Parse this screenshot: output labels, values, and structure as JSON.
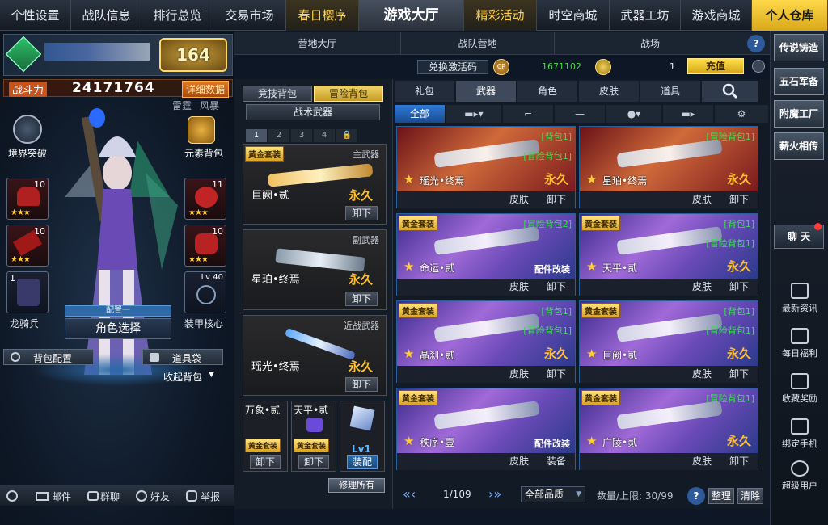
{
  "topnav": {
    "items": [
      "个性设置",
      "战队信息",
      "排行总览",
      "交易市场",
      "春日樱序",
      "游戏大厅",
      "精彩活动",
      "时空商城",
      "武器工坊",
      "游戏商城",
      "个人仓库"
    ]
  },
  "player": {
    "level": "164",
    "power_label": "战斗力",
    "power_value": "24171764",
    "detail_button": "详细数据",
    "tag_left": "雷霆",
    "tag_right": "风暴",
    "realm_breakthrough": "境界突破",
    "element_bag": "元素背包",
    "slots": [
      {
        "num": "10",
        "stars": "★★★"
      },
      {
        "num": "10",
        "stars": "★★★"
      },
      {
        "num": "10",
        "stars": "★★★"
      },
      {
        "num": "11",
        "stars": "★★★"
      },
      {
        "num": "10",
        "stars": "★★★"
      }
    ],
    "dragon_num": "1",
    "dragon_label": "龙骑兵",
    "armor_level": "Lv 40",
    "armor_label": "装甲核心",
    "config_label": "配置一",
    "role_select": "角色选择",
    "bag_config": "背包配置",
    "item_bag": "道具袋",
    "collapse_bag": "收起背包"
  },
  "bottom_left": {
    "mail": "邮件",
    "group_chat": "群聊",
    "friends": "好友",
    "report": "举报"
  },
  "camp_tabs": [
    "营地大厅",
    "战队营地",
    "战场"
  ],
  "currency": {
    "redeem": "兑换激活码",
    "cp_value": "1671102",
    "coin_value": "1",
    "recharge": "充值"
  },
  "mid": {
    "tab_compete": "竞技背包",
    "tab_adventure": "冒险背包",
    "tactical": "战术武器",
    "pages": [
      "1",
      "2",
      "3",
      "4"
    ],
    "cards": [
      {
        "tag": "黄金套装",
        "type": "主武器",
        "name": "巨阙•贰",
        "status": "永久",
        "btn": "卸下"
      },
      {
        "tag": "",
        "type": "副武器",
        "name": "星珀•终焉",
        "status": "永久",
        "btn": "卸下"
      },
      {
        "tag": "",
        "type": "近战武器",
        "name": "瑶光•终焉",
        "status": "永久",
        "btn": "卸下"
      }
    ],
    "small": [
      {
        "name": "万象•贰",
        "tag": "黄金套装",
        "btn": "卸下"
      },
      {
        "name": "天平•贰",
        "tag": "黄金套装",
        "btn": "卸下"
      }
    ],
    "lv": "Lv1",
    "equip": "装配",
    "repair_all": "修理所有"
  },
  "categories": [
    "礼包",
    "武器",
    "角色",
    "皮肤",
    "道具"
  ],
  "filter": {
    "all": "全部"
  },
  "grid": [
    {
      "tag": "",
      "g1": "[背包1]",
      "g2": "[冒险背包1]",
      "name": "瑶光•终焉",
      "status": "永久",
      "parts": "",
      "b1": "皮肤",
      "b2": "卸下",
      "bg": "red"
    },
    {
      "tag": "",
      "g1": "[冒险背包1]",
      "g2": "",
      "name": "星珀•终焉",
      "status": "永久",
      "parts": "",
      "b1": "皮肤",
      "b2": "卸下",
      "bg": "red"
    },
    {
      "tag": "黄金套装",
      "g1": "[冒险背包2]",
      "g2": "",
      "name": "命运•贰",
      "status": "",
      "parts": "配件改装",
      "b1": "皮肤",
      "b2": "卸下",
      "bg": "purple"
    },
    {
      "tag": "黄金套装",
      "g1": "[背包1]",
      "g2": "[冒险背包1]",
      "name": "天平•贰",
      "status": "永久",
      "parts": "",
      "b1": "皮肤",
      "b2": "卸下",
      "bg": "purple"
    },
    {
      "tag": "黄金套装",
      "g1": "[背包1]",
      "g2": "[冒险背包1]",
      "name": "晶刹•贰",
      "status": "永久",
      "parts": "",
      "b1": "皮肤",
      "b2": "卸下",
      "bg": "purple"
    },
    {
      "tag": "黄金套装",
      "g1": "[背包1]",
      "g2": "[冒险背包1]",
      "name": "巨阙•贰",
      "status": "永久",
      "parts": "",
      "b1": "皮肤",
      "b2": "卸下",
      "bg": "purple"
    },
    {
      "tag": "黄金套装",
      "g1": "",
      "g2": "",
      "name": "秩序•壹",
      "status": "",
      "parts": "配件改装",
      "b1": "皮肤",
      "b2": "装备",
      "bg": "purple"
    },
    {
      "tag": "黄金套装",
      "g1": "[冒险背包1]",
      "g2": "",
      "name": "广陵•贰",
      "status": "永久",
      "parts": "",
      "b1": "皮肤",
      "b2": "卸下",
      "bg": "purple"
    }
  ],
  "pager": {
    "page": "1/109",
    "quality": "全部品质",
    "count": "数量/上限: 30/99",
    "sort": "整理",
    "clear": "清除"
  },
  "sidebar": {
    "buttons": [
      "传说铸造",
      "五石军备",
      "附魔工厂",
      "薪火相传"
    ],
    "chat": "聊 天",
    "links": [
      "最新资讯",
      "每日福利",
      "收藏奖励",
      "绑定手机",
      "超级用户"
    ]
  },
  "colors": {
    "gold": "#ffbf2a",
    "green": "#38e04a",
    "accent_blue": "#2a5e9a"
  }
}
